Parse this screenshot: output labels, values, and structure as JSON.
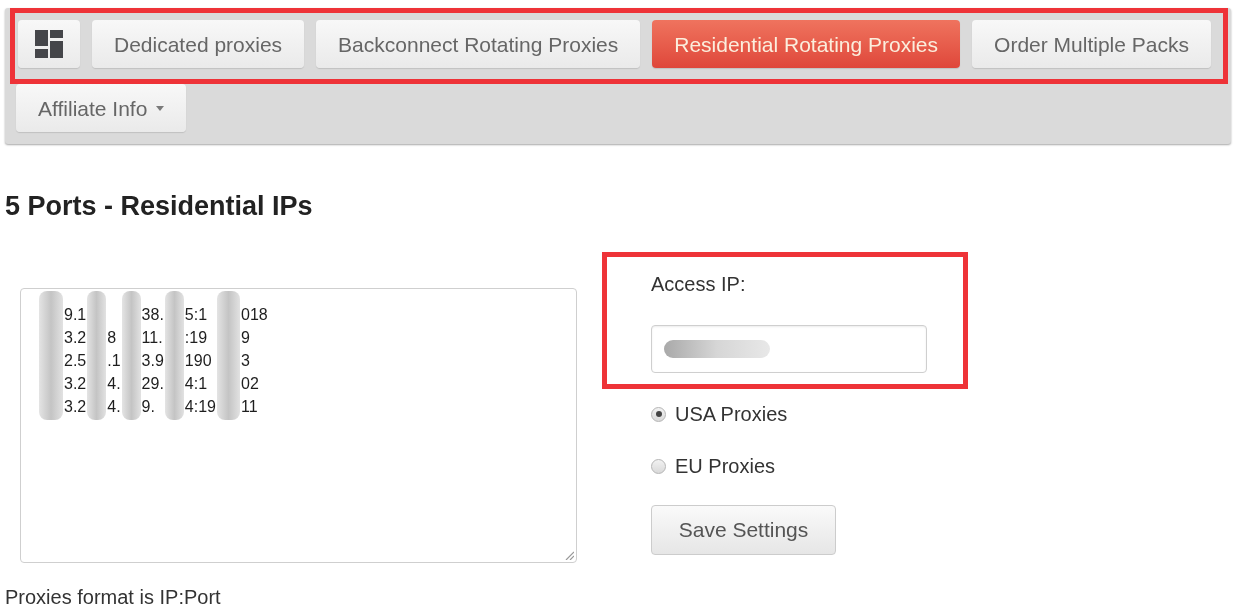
{
  "nav": {
    "rows": [
      {
        "highlighted": true,
        "items": [
          {
            "kind": "icon",
            "selected": false
          },
          {
            "kind": "link",
            "label": "Dedicated proxies",
            "selected": false
          },
          {
            "kind": "link",
            "label": "Backconnect Rotating Proxies",
            "selected": false
          },
          {
            "kind": "link",
            "label": "Residential Rotating Proxies",
            "selected": true
          },
          {
            "kind": "link",
            "label": "Order Multiple Packs",
            "selected": false
          }
        ]
      },
      {
        "highlighted": false,
        "items": [
          {
            "kind": "dropdown",
            "label": "Affiliate Info",
            "selected": false
          }
        ]
      }
    ]
  },
  "heading": "5 Ports - Residential IPs",
  "proxy_list": {
    "lines": [
      {
        "parts": [
          {
            "kind": "text",
            "text": "9.1"
          },
          {
            "kind": "hidden"
          },
          {
            "kind": "text",
            "text": "38."
          },
          {
            "kind": "text",
            "text": "5:1"
          },
          {
            "kind": "text",
            "text": "018"
          }
        ]
      },
      {
        "parts": [
          {
            "kind": "text",
            "text": "3.2"
          },
          {
            "kind": "text",
            "text": "8"
          },
          {
            "kind": "text",
            "text": "11."
          },
          {
            "kind": "text",
            "text": ":19"
          },
          {
            "kind": "text",
            "text": "9"
          }
        ]
      },
      {
        "parts": [
          {
            "kind": "text",
            "text": "2.5"
          },
          {
            "kind": "text",
            "text": ".1"
          },
          {
            "kind": "text",
            "text": "3.9"
          },
          {
            "kind": "text",
            "text": "190"
          },
          {
            "kind": "text",
            "text": "3"
          }
        ]
      },
      {
        "parts": [
          {
            "kind": "text",
            "text": "3.2"
          },
          {
            "kind": "text",
            "text": "4."
          },
          {
            "kind": "text",
            "text": "29."
          },
          {
            "kind": "text",
            "text": "4:1"
          },
          {
            "kind": "text",
            "text": "02"
          }
        ]
      },
      {
        "parts": [
          {
            "kind": "text",
            "text": "3.2"
          },
          {
            "kind": "text",
            "text": "4."
          },
          {
            "kind": "text",
            "text": "9."
          },
          {
            "kind": "text",
            "text": "4:19"
          },
          {
            "kind": "text",
            "text": "11"
          }
        ]
      }
    ]
  },
  "access_ip": {
    "highlighted": true,
    "label": "Access IP:"
  },
  "region": [
    {
      "label": "USA Proxies",
      "selected": true
    },
    {
      "label": "EU Proxies",
      "selected": false
    }
  ],
  "save_button": "Save Settings",
  "format_note": "Proxies format is IP:Port"
}
